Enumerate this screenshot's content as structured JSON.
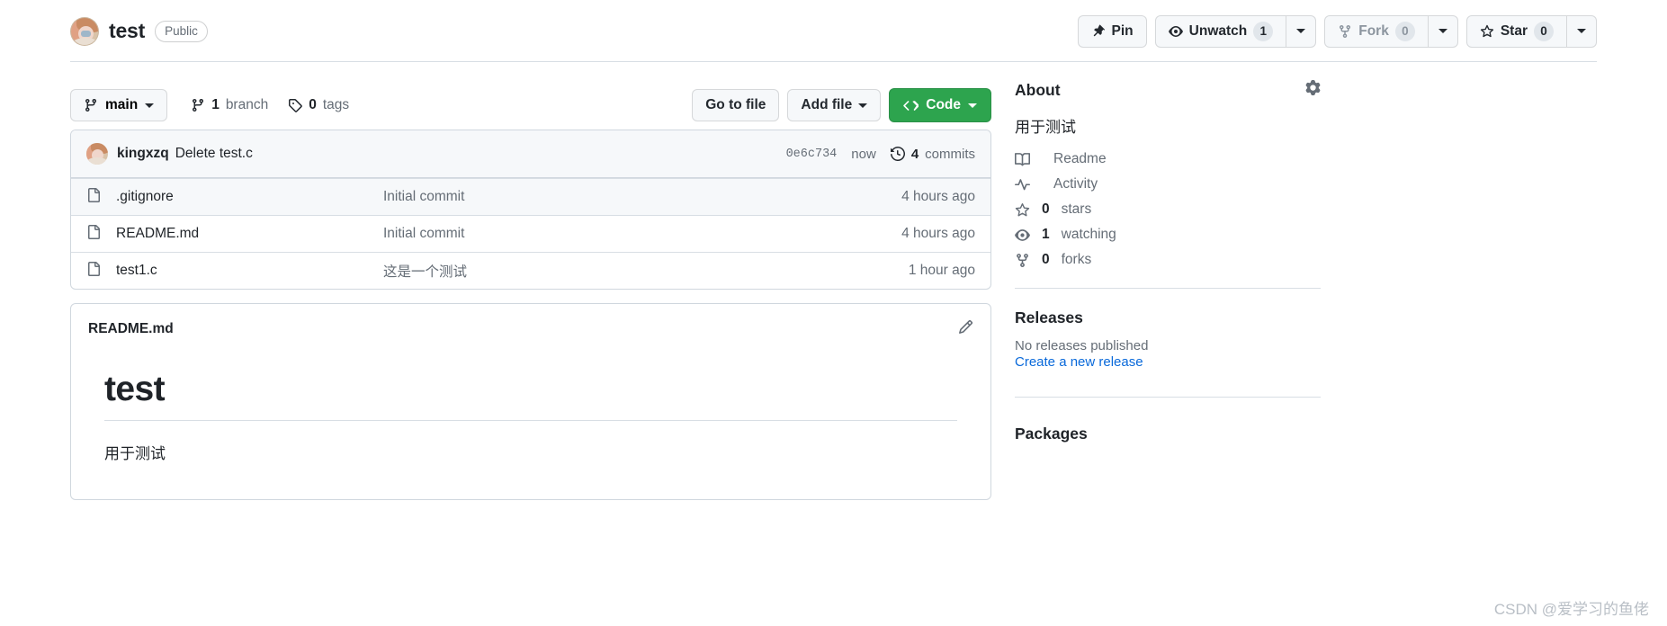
{
  "header": {
    "repo_name": "test",
    "visibility": "Public",
    "avatar_icon": "user-avatar",
    "actions": {
      "pin_label": "Pin",
      "pin_icon": "pin-icon",
      "unwatch_label": "Unwatch",
      "unwatch_icon": "eye-icon",
      "unwatch_count": "1",
      "fork_label": "Fork",
      "fork_icon": "repo-forked-icon",
      "fork_count": "0",
      "star_label": "Star",
      "star_icon": "star-icon",
      "star_count": "0"
    }
  },
  "branch_bar": {
    "branch_icon": "git-branch-icon",
    "branch_name": "main",
    "branches_count": "1",
    "branches_label": "branch",
    "tags_icon": "tag-icon",
    "tags_count": "0",
    "tags_label": "tags",
    "go_to_file": "Go to file",
    "add_file": "Add file",
    "code_label": "Code",
    "code_icon": "code-icon",
    "code_color": "#2da44e"
  },
  "latest_commit": {
    "author": "kingxzq",
    "message": "Delete test.c",
    "sha": "0e6c734",
    "when": "now",
    "commits_count": "4",
    "commits_label": "commits",
    "history_icon": "history-icon"
  },
  "files": [
    {
      "icon": "file-icon",
      "name": ".gitignore",
      "message": "Initial commit",
      "time": "4 hours ago"
    },
    {
      "icon": "file-icon",
      "name": "README.md",
      "message": "Initial commit",
      "time": "4 hours ago"
    },
    {
      "icon": "file-icon",
      "name": "test1.c",
      "message": "这是一个测试",
      "time": "1 hour ago"
    }
  ],
  "readme": {
    "filename": "README.md",
    "edit_icon": "pencil-icon",
    "heading": "test",
    "paragraph": "用于测试"
  },
  "sidebar": {
    "about_title": "About",
    "gear_icon": "gear-icon",
    "description": "用于测试",
    "items": [
      {
        "icon": "book-icon",
        "label": "Readme",
        "strong": ""
      },
      {
        "icon": "pulse-icon",
        "label": "Activity",
        "strong": ""
      },
      {
        "icon": "star-icon",
        "label": "stars",
        "strong": "0"
      },
      {
        "icon": "eye-icon",
        "label": "watching",
        "strong": "1"
      },
      {
        "icon": "repo-forked-icon",
        "label": "forks",
        "strong": "0"
      }
    ],
    "releases_title": "Releases",
    "releases_none": "No releases published",
    "releases_link": "Create a new release",
    "packages_title": "Packages"
  },
  "watermark": "CSDN @爱学习的鱼佬"
}
